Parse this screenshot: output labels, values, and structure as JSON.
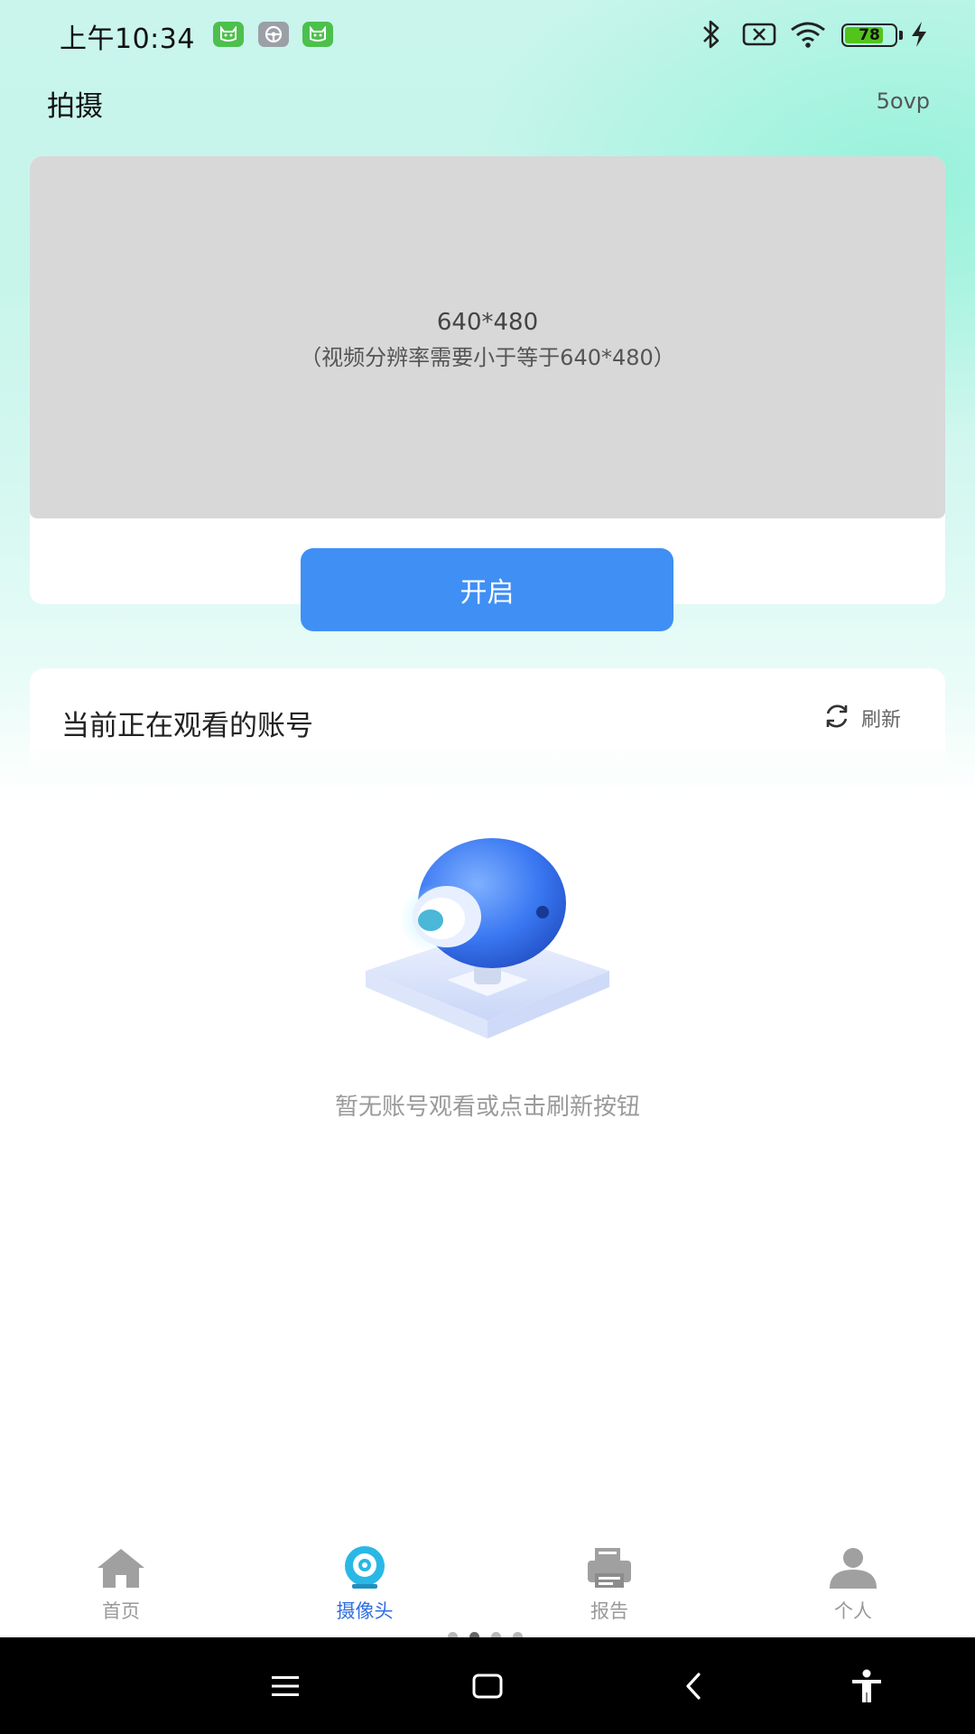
{
  "status_bar": {
    "time": "上午10:34",
    "battery_level": 78,
    "battery_text": "78",
    "icons": [
      "app-cat-icon",
      "steering-wheel-icon",
      "app-cat-icon",
      "bluetooth-icon",
      "no-sim-icon",
      "wifi-icon",
      "battery-icon",
      "charging-icon"
    ]
  },
  "header": {
    "title": "拍摄",
    "version": "5ovp"
  },
  "preview": {
    "resolution": "640*480",
    "note": "（视频分辨率需要小于等于640*480）",
    "start_button": "开启"
  },
  "watching": {
    "title": "当前正在观看的账号",
    "refresh_label": "刷新",
    "empty_text": "暂无账号观看或点击刷新按钮"
  },
  "bottom_nav": {
    "items": [
      {
        "label": "首页",
        "icon": "home-icon",
        "active": false
      },
      {
        "label": "摄像头",
        "icon": "webcam-icon",
        "active": true
      },
      {
        "label": "报告",
        "icon": "report-printer-icon",
        "active": false
      },
      {
        "label": "个人",
        "icon": "person-icon",
        "active": false
      }
    ],
    "pages": 4,
    "current_page": 2
  },
  "system_nav": {
    "buttons": [
      "menu-icon",
      "home-square-icon",
      "back-icon",
      "accessibility-icon"
    ]
  },
  "colors": {
    "accent": "#3f8ff5",
    "active_nav": "#2f6fe0",
    "preview_bg": "#d8d8d8",
    "gradient_top": "#c9f5ec"
  }
}
